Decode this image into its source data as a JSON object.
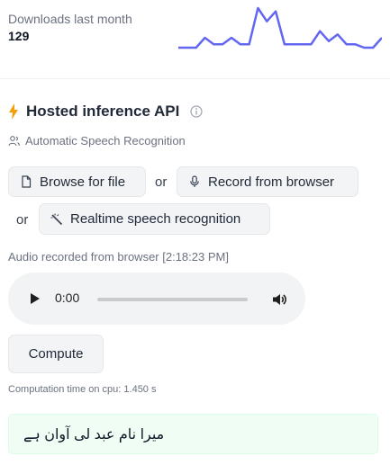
{
  "downloads": {
    "label": "Downloads last month",
    "count": "129"
  },
  "sparkline": {
    "values": [
      0,
      0,
      0,
      3,
      1,
      1,
      3,
      1,
      1,
      12,
      8,
      11,
      1,
      1,
      1,
      1,
      5,
      2,
      4,
      1,
      1,
      0,
      0,
      3
    ],
    "color": "#6366f1"
  },
  "api": {
    "title": "Hosted inference API",
    "task": "Automatic Speech Recognition"
  },
  "buttons": {
    "browse": "Browse for file",
    "record": "Record from browser",
    "realtime": "Realtime speech recognition",
    "compute": "Compute"
  },
  "or1": "or",
  "or2": "or",
  "audio": {
    "label": "Audio recorded from browser [2:18:23 PM]",
    "time": "0:00"
  },
  "computation_time": "Computation time on cpu: 1.450 s",
  "output_text": "میرا نام عبد لی آوان ہے"
}
